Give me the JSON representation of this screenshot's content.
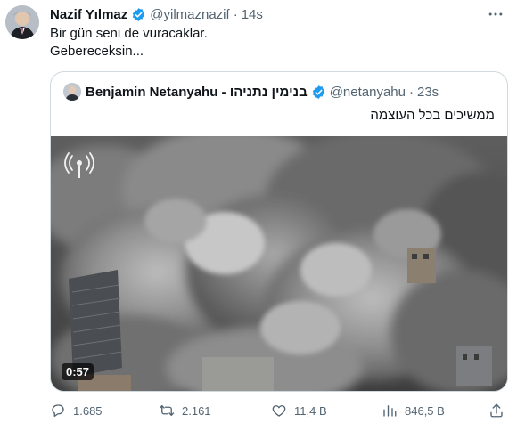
{
  "author": {
    "name": "Nazif Yılmaz",
    "handle": "@yilmaznazif",
    "time": "14s"
  },
  "tweet": {
    "line1": "Bir gün seni de vuracaklar.",
    "line2": "Gebereceksin..."
  },
  "quoted": {
    "name": "Benjamin Netanyahu - בנימין נתניהו",
    "handle": "@netanyahu",
    "time": "23s",
    "text": "ממשיכים בכל העוצמה",
    "video_duration": "0:57"
  },
  "actions": {
    "replies": "1.685",
    "retweets": "2.161",
    "likes": "11,4 B",
    "views": "846,5 B"
  },
  "colors": {
    "verified": "#1d9bf0",
    "muted": "#536471",
    "border": "#cfd9de"
  },
  "icons": [
    "reply-icon",
    "retweet-icon",
    "like-icon",
    "views-icon",
    "share-icon",
    "more-icon",
    "verified-badge-icon",
    "broadcast-icon"
  ]
}
